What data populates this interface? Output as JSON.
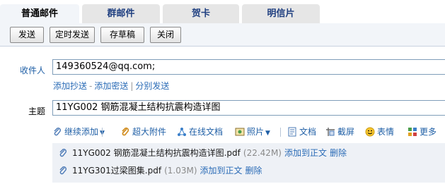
{
  "tabs": [
    {
      "label": "普通邮件",
      "active": true
    },
    {
      "label": "群邮件",
      "active": false
    },
    {
      "label": "贺卡",
      "active": false
    },
    {
      "label": "明信片",
      "active": false
    }
  ],
  "toolbar": {
    "send": "发送",
    "schedule": "定时发送",
    "draft": "存草稿",
    "close": "关闭"
  },
  "compose": {
    "to_label": "收件人",
    "to_value": "149360524@qq.com;",
    "add_cc": "添加抄送",
    "dash": "-",
    "add_bcc": "添加密送",
    "pipe": "|",
    "separate_send": "分别发送",
    "subject_label": "主题",
    "subject_value": "11YG002 钢筋混凝土结构抗震构造详图"
  },
  "attach_toolbar": {
    "continue_add": "继续添加",
    "large_attach": "超大附件",
    "online_doc": "在线文档",
    "photo": "照片",
    "document": "文档",
    "screenshot": "截屏",
    "emoji": "表情",
    "more": "更多"
  },
  "attachments": [
    {
      "name": "11YG002 钢筋混凝土结构抗震构造详图.pdf",
      "size": "(22.42M)",
      "add_to_body": "添加到正文",
      "delete": "删除"
    },
    {
      "name": "11YG301过梁图集.pdf",
      "size": "(1.03M)",
      "add_to_body": "添加到正文",
      "delete": "删除"
    }
  ],
  "colors": {
    "accent": "#1f5fa6",
    "toolbar_bg": "#f2f5f9",
    "list_bg": "#eef1f6"
  }
}
